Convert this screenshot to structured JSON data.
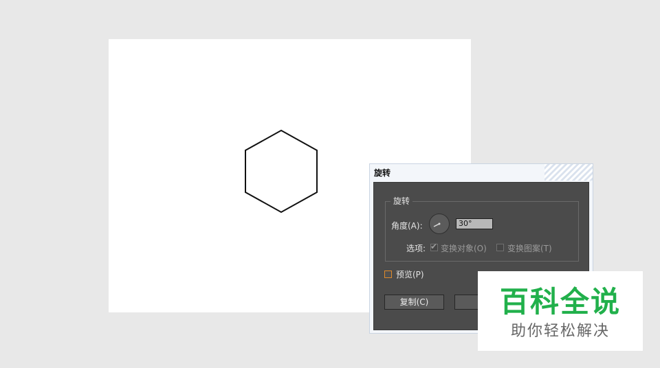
{
  "dialog": {
    "title": "旋转",
    "group_title": "旋转",
    "angle_label": "角度(A):",
    "angle_value": "30°",
    "options_label": "选项:",
    "transform_objects_label": "变换对象(O)",
    "transform_objects_checked": true,
    "transform_patterns_label": "变换图案(T)",
    "transform_patterns_checked": false,
    "preview_label": "预览(P)",
    "preview_checked": false,
    "copy_button": "复制(C)"
  },
  "watermark": {
    "title": "百科全说",
    "subtitle": "助你轻松解决"
  },
  "colors": {
    "dialog_bg": "#4b4b4b",
    "watermark_green": "#21b04b",
    "preview_checkbox_border": "#e08a2a"
  }
}
